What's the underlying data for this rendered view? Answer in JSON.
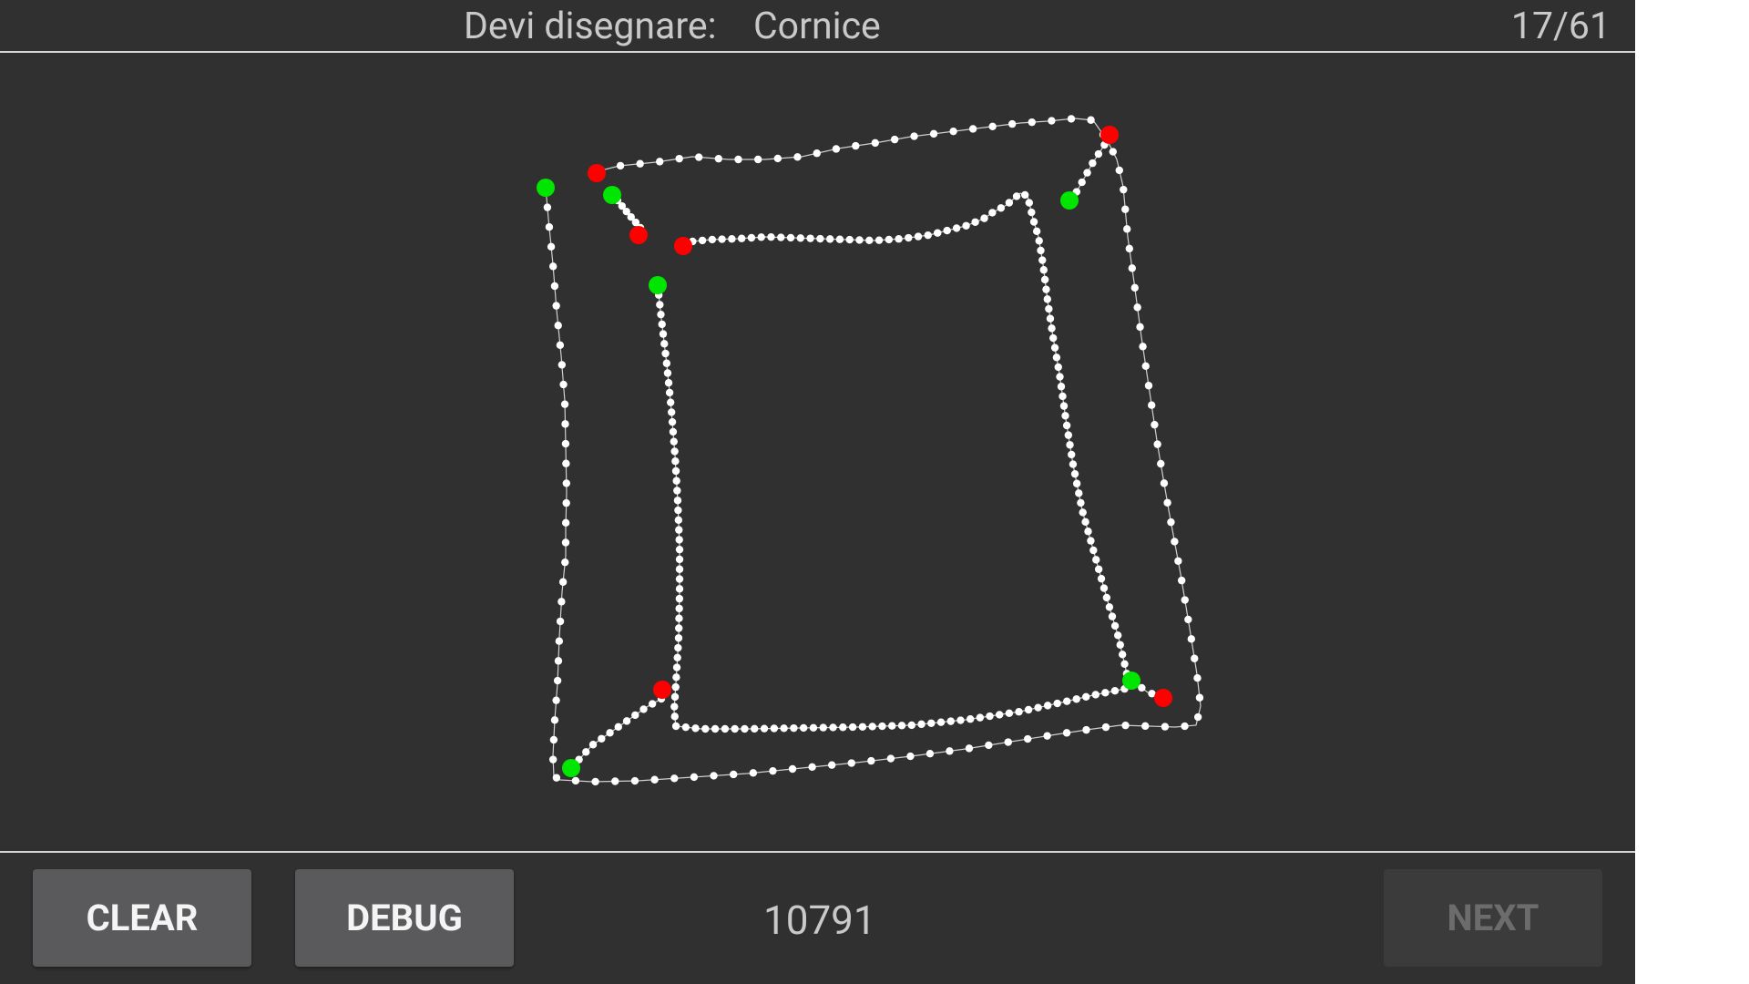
{
  "header": {
    "prompt_label": "Devi disegnare:",
    "prompt_word": "Cornice",
    "progress": "17/61"
  },
  "footer": {
    "clear_label": "CLEAR",
    "debug_label": "DEBUG",
    "score": "10791",
    "next_label": "NEXT",
    "next_enabled": false
  },
  "colors": {
    "background": "#303030",
    "stroke_point": "#ffffff",
    "stroke_start": "#00e600",
    "stroke_end": "#ff0000"
  }
}
